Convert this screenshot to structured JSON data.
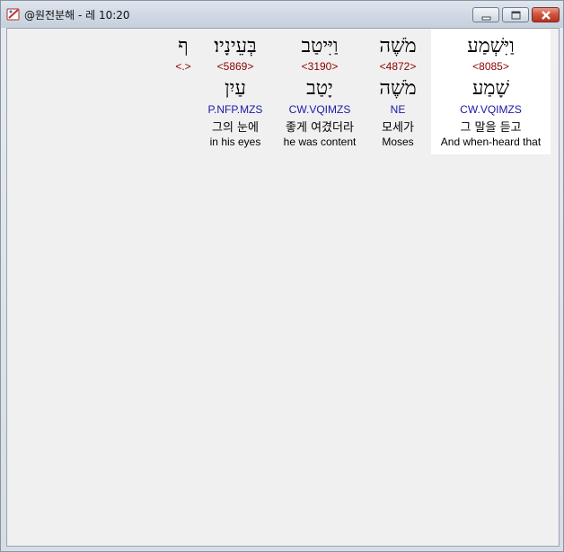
{
  "window": {
    "title": "@원전분해 - 레 10:20",
    "buttons": {
      "minimize": "minimize",
      "maximize": "maximize",
      "close": "close"
    }
  },
  "words": [
    {
      "hebrew": "וַיִּשְׁמַע",
      "strong": "<8085>",
      "lemma": "שָׁמַע",
      "parse": "CW.VQIMZS",
      "korean": "그 말을 듣고",
      "english": "And when-heard that",
      "highlighted": true
    },
    {
      "hebrew": "מֹשֶׁה",
      "strong": "<4872>",
      "lemma": "מֹשֶׁה",
      "parse": "NE",
      "korean": "모세가",
      "english": "Moses",
      "highlighted": false
    },
    {
      "hebrew": "וַיִּיטַב",
      "strong": "<3190>",
      "lemma": "יָטַב",
      "parse": "CW.VQIMZS",
      "korean": "좋게 여겼더라",
      "english": "he was content",
      "highlighted": false
    },
    {
      "hebrew": "בְּעֵינָיו׃",
      "strong": "<5869>",
      "lemma": "עַיִן",
      "parse": "P.NFP.MZS",
      "korean": "그의 눈에",
      "english": "in his eyes",
      "highlighted": false
    },
    {
      "hebrew": "ף",
      "strong": "<.>",
      "lemma": "",
      "parse": "",
      "korean": "",
      "english": "",
      "highlighted": false
    }
  ]
}
